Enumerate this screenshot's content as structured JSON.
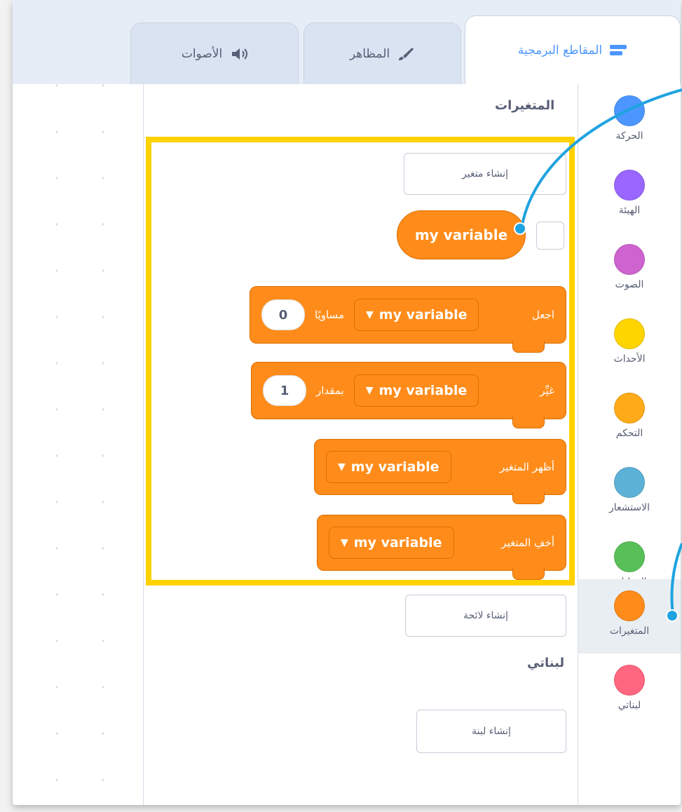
{
  "tabs": [
    {
      "label": "المقاطع البرمجية",
      "icon": "code-blocks-icon",
      "active": true
    },
    {
      "label": "المظاهر",
      "icon": "brush-icon",
      "active": false
    },
    {
      "label": "الأصوات",
      "icon": "speaker-icon",
      "active": false
    }
  ],
  "categories": [
    {
      "label": "الحركة",
      "color": "#4c97ff"
    },
    {
      "label": "الهيئة",
      "color": "#9966ff"
    },
    {
      "label": "الصوت",
      "color": "#cf63cf"
    },
    {
      "label": "الأحداث",
      "color": "#ffd500"
    },
    {
      "label": "التحكم",
      "color": "#ffab19"
    },
    {
      "label": "الاستشعار",
      "color": "#5cb1d6"
    },
    {
      "label": "العمليات",
      "color": "#59c059"
    },
    {
      "label": "المتغيرات",
      "color": "#ff8c1a",
      "selected": true
    },
    {
      "label": "لبناتي",
      "color": "#ff6680"
    }
  ],
  "palette": {
    "variables_title": "المتغيرات",
    "make_variable_button": "إنشاء متغير",
    "variable_reporter": "my variable",
    "set_block": {
      "verb": "اجعل",
      "variable": "my variable",
      "connector": "مساويًا",
      "value": "0"
    },
    "change_block": {
      "verb": "غيِّر",
      "variable": "my variable",
      "connector": "بمقدار",
      "value": "1"
    },
    "show_block": {
      "verb": "أظهر المتغير",
      "variable": "my variable"
    },
    "hide_block": {
      "verb": "أخفِ المتغير",
      "variable": "my variable"
    },
    "make_list_button": "إنشاء لائحة",
    "my_blocks_title": "لبناتي",
    "make_block_button": "إنشاء لبنة"
  },
  "colors": {
    "variables_accent": "#ff8c1a",
    "highlight": "#ffd200",
    "callout": "#1fa3e0"
  }
}
